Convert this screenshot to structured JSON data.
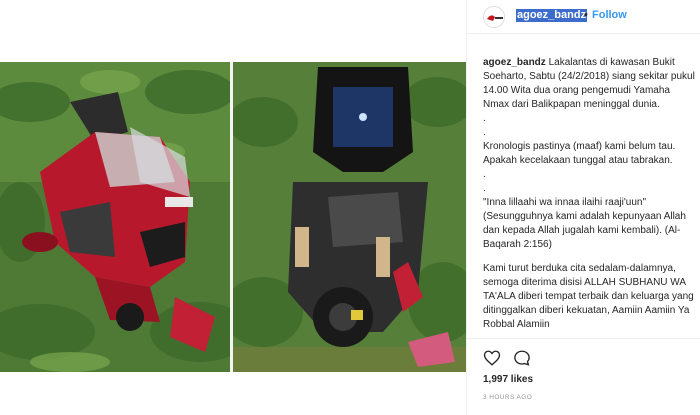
{
  "header": {
    "username": "agoez_bandz",
    "separator": "•",
    "follow_label": "Follow",
    "avatar_text": "agoez bandz"
  },
  "caption": {
    "author": "agoez_bandz",
    "line1": "Lakalantas di kawasan Bukit Soeharto, Sabtu (24/2/2018) siang sekitar pukul 14.00 Wita dua orang pengemudi Yamaha Nmax dari Balikpapan meninggal dunia.",
    "dot1": ".",
    "dot2": ".",
    "line2": "Kronologis pastinya (maaf) kami belum tau. Apakah kecelakaan tunggal atau tabrakan.",
    "dot3": ".",
    "dot4": ".",
    "line3": "\"Inna lillaahi wa innaa ilaihi raaji'uun\" (Sesungguhnya kami adalah kepunyaan Allah dan kepada Allah jugalah kami kembali). (Al-Baqarah 2:156)",
    "line4": "Kami turut berduka cita sedalam-dalamnya, semoga diterima disisi ALLAH SUBHANU WA TA'ALA diberi tempat terbaik dan keluarga yang ditinggalkan diberi kekuatan, Aamiin Aamiin Ya Robbal Alamiin"
  },
  "actions": {
    "like_icon": "heart-icon",
    "comment_icon": "comment-icon"
  },
  "likes_text": "1,997 likes",
  "time_text": "3 HOURS AGO",
  "colors": {
    "follow": "#3897f0",
    "username_highlight": "#3d6dcc",
    "scooter_red": "#b8182c"
  }
}
